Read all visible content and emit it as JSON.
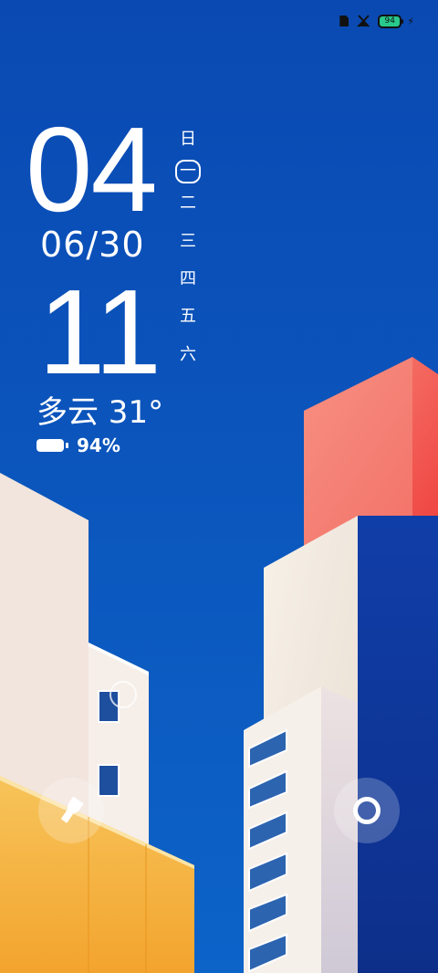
{
  "status_bar": {
    "battery_level": "94",
    "icons": [
      "sim-card-icon",
      "no-network-icon",
      "battery-icon",
      "charging-bolt-icon"
    ]
  },
  "clock": {
    "hour": "04",
    "minute": "11",
    "date": "06/30"
  },
  "weekday_column": {
    "days": [
      "日",
      "一",
      "二",
      "三",
      "四",
      "五",
      "六"
    ],
    "active_index": 1
  },
  "weather": {
    "text": "多云 31°"
  },
  "battery": {
    "percent": "94%"
  },
  "shortcuts": {
    "left_icon": "flashlight-icon",
    "right_icon": "camera-icon"
  },
  "colors": {
    "sky": "#0a4bb3",
    "pink_block": "#f2604f",
    "cream": "#f3ece2",
    "yellow": "#f6b544",
    "charging_green": "#28c98b"
  }
}
